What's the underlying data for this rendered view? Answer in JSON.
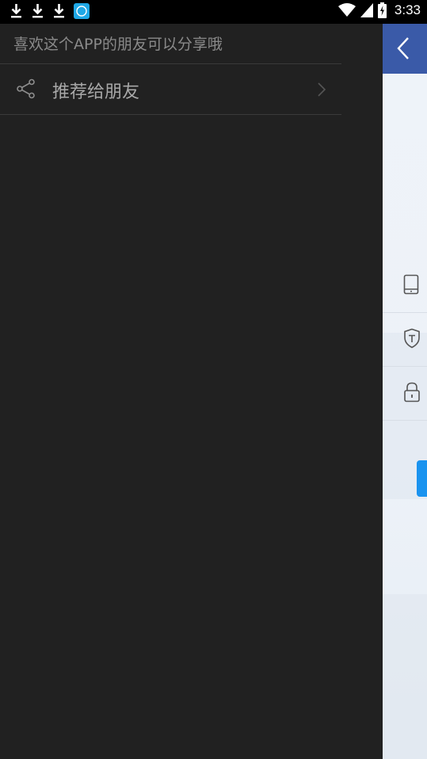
{
  "status_bar": {
    "time": "3:33",
    "notification_icons": [
      "download-icon",
      "download-icon",
      "download-icon",
      "app-notification-icon"
    ],
    "system_icons": [
      "wifi-icon",
      "cellular-signal-icon",
      "battery-charging-icon"
    ]
  },
  "drawer": {
    "hint_text": "喜欢这个APP的朋友可以分享哦",
    "items": [
      {
        "label": "推荐给朋友",
        "icon": "share-icon",
        "trailing_icon": "chevron-right-icon"
      }
    ]
  },
  "background_page": {
    "header_icon": "back-chevron-icon",
    "row_icons": [
      "phone-icon",
      "shield-icon",
      "lock-icon"
    ],
    "colors": {
      "header": "#3a5aa8",
      "button": "#1a93ef"
    }
  },
  "colors": {
    "drawer_bg": "#212121",
    "status_bar_bg": "#000000",
    "hint_text": "#8a8a8a",
    "item_text": "#a8a8a8",
    "divider": "#3a3a3a"
  }
}
